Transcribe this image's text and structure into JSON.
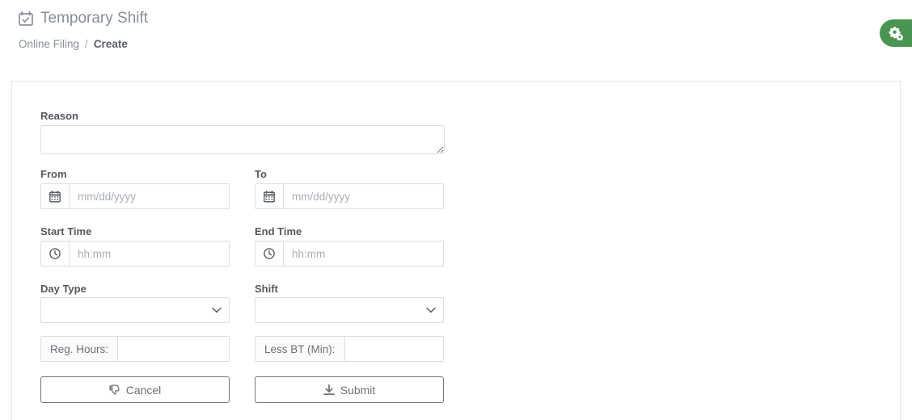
{
  "header": {
    "title": "Temporary Shift",
    "title_icon": "calendar-check-icon",
    "breadcrumb": {
      "parent": "Online Filing",
      "separator": "/",
      "current": "Create"
    },
    "settings_button": {
      "icon": "cogs-icon",
      "color": "#4a9552"
    }
  },
  "form": {
    "reason": {
      "label": "Reason",
      "value": "",
      "placeholder": ""
    },
    "from": {
      "label": "From",
      "icon": "calendar-icon",
      "value": "",
      "placeholder": "mm/dd/yyyy"
    },
    "to": {
      "label": "To",
      "icon": "calendar-icon",
      "value": "",
      "placeholder": "mm/dd/yyyy"
    },
    "start_time": {
      "label": "Start Time",
      "icon": "clock-icon",
      "value": "",
      "placeholder": "hh:mm"
    },
    "end_time": {
      "label": "End Time",
      "icon": "clock-icon",
      "value": "",
      "placeholder": "hh:mm"
    },
    "day_type": {
      "label": "Day Type",
      "selected": "",
      "options": [
        ""
      ]
    },
    "shift": {
      "label": "Shift",
      "selected": "",
      "options": [
        ""
      ]
    },
    "reg_hours": {
      "addon_label": "Reg. Hours:",
      "value": "",
      "placeholder": ""
    },
    "less_bt": {
      "addon_label": "Less BT (Min):",
      "value": "",
      "placeholder": ""
    }
  },
  "actions": {
    "cancel": {
      "label": "Cancel",
      "icon": "thumbs-down-icon"
    },
    "submit": {
      "label": "Submit",
      "icon": "download-icon"
    }
  }
}
